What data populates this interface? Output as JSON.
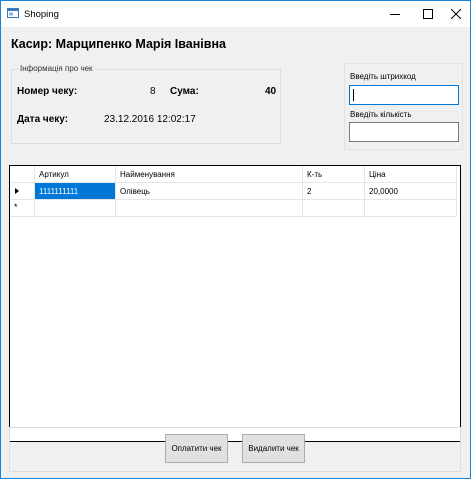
{
  "window": {
    "title": "Shoping"
  },
  "cashier": {
    "text": "Касир: Марципенко Марія Іванівна"
  },
  "receipt_info": {
    "legend": "Інформація про чек",
    "number_label": "Номер чеку:",
    "number_value": "8",
    "sum_label": "Сума:",
    "sum_value": "40",
    "date_label": "Дата чеку:",
    "date_value": "23.12.2016 12:02:17"
  },
  "inputs": {
    "barcode_label": "Введіть штрихкод",
    "barcode_value": "",
    "quantity_label": "Введіть кількість",
    "quantity_value": ""
  },
  "table": {
    "columns": [
      "Артикул",
      "Найменування",
      "К-ть",
      "Ціна"
    ],
    "rows": [
      {
        "article": "1111111111",
        "name": "Олівець",
        "qty": "2",
        "price": "20,0000"
      }
    ],
    "new_row_marker": "*"
  },
  "buttons": {
    "pay_label": "Оплатити чек",
    "delete_label": "Видалити чек"
  },
  "colors": {
    "selection": "#0078d7",
    "window_border": "#1883d7",
    "background": "#f0f0f0"
  },
  "icons": {
    "app": "form-app-icon",
    "minimize": "minimize-icon",
    "maximize": "maximize-icon",
    "close": "close-icon",
    "current_row": "row-pointer-icon"
  }
}
